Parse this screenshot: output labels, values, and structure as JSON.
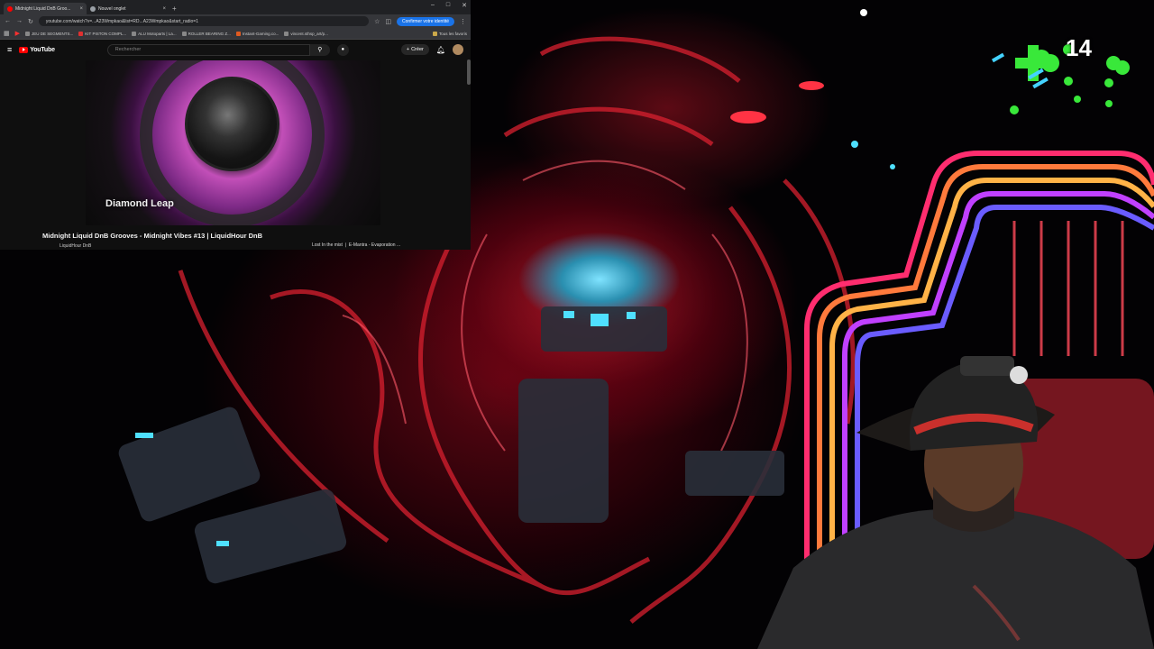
{
  "browser": {
    "tabs": [
      {
        "title": "Midnight Liquid DnB Groo...",
        "active": true,
        "favicon_color": "#ff0000"
      },
      {
        "title": "Nouvel onglet",
        "active": false,
        "favicon_color": "#9aa0a6"
      }
    ],
    "new_tab_label": "+",
    "url": "youtube.com/watch?v=...A23Wmpkao&list=RD...A23Wmpkao&start_radio=1",
    "confirm_identity_label": "Confirmer votre identité",
    "bookmarks": [
      {
        "label": "JEU DE SEGMENTS..."
      },
      {
        "label": "KIT PISTON COMPL..."
      },
      {
        "label": "ALU Motoparts | La..."
      },
      {
        "label": "ROLLER BEARING Z..."
      },
      {
        "label": "Instant-Gaming.co..."
      },
      {
        "label": "vincent.sthsp_art/p..."
      }
    ],
    "all_bookmarks_label": "Tous les favoris"
  },
  "youtube": {
    "logo_text": "YouTube",
    "search_placeholder": "Rechercher",
    "create_label": "Créer",
    "video_caption": "Diamond Leap",
    "video_title": "Midnight Liquid DnB Grooves - Midnight Vibes #13 | LiquidHour DnB",
    "channel_name": "LiquidHour DnB",
    "up_next": "Lost In the mist ❘ E-Mantra - Evaporation ..."
  },
  "stream_overlay": {
    "like_count": "14",
    "heart_color": "#39e83a"
  },
  "icons": {
    "back": "arrow-left-icon",
    "forward": "arrow-right-icon",
    "reload": "reload-icon",
    "menu": "menu-icon",
    "search": "search-icon",
    "mic": "mic-icon",
    "bell": "bell-icon"
  }
}
